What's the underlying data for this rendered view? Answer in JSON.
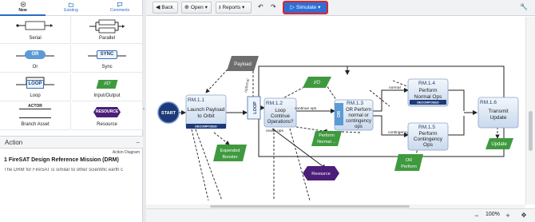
{
  "palette": {
    "tabs": [
      {
        "label": "New",
        "icon": "plus-circle-icon"
      },
      {
        "label": "Existing",
        "icon": "folder-icon"
      },
      {
        "label": "Comments",
        "icon": "comment-icon"
      }
    ],
    "items": [
      {
        "label": "Serial",
        "glyph": ""
      },
      {
        "label": "Parallel",
        "glyph": ""
      },
      {
        "label": "Or",
        "glyph": "OR"
      },
      {
        "label": "Sync",
        "glyph": "SYNC"
      },
      {
        "label": "Loop",
        "glyph": "LOOP"
      },
      {
        "label": "Input/Output",
        "glyph": "I/O"
      },
      {
        "label": "Branch Asset",
        "glyph": "ACTOR"
      },
      {
        "label": "Resource",
        "glyph": "RESOURCE"
      }
    ]
  },
  "action_panel": {
    "title": "Action",
    "collapse_icon": "−",
    "subtype": "Action Diagram",
    "name": "1 FireSAT Design Reference Mission (DRM)",
    "description": "The DRM for FireSAT is similar to other scientific earth c"
  },
  "toolbar": {
    "back": "Back",
    "open": "Open",
    "reports": "Reports",
    "simulate": "Simulate",
    "accent_color": "#2f6fd3",
    "highlight_color": "#e0232d"
  },
  "diagram": {
    "start": "START",
    "nodes": {
      "rm11": {
        "id": "RM.1.1",
        "line1": "Launch Payload",
        "line2": "to Orbit",
        "badge": "DECOMPOSED"
      },
      "rm12": {
        "id": "RM.1.2",
        "line1": "Loop",
        "line2": "Continue",
        "line3": "Operations?"
      },
      "rm13": {
        "id": "RM.1.3",
        "line1": "OR Perform",
        "line2": "normal or",
        "line3": "contingency",
        "line4": "ops"
      },
      "rm14": {
        "id": "RM.1.4",
        "line1": "Perform",
        "line2": "Normal Ops",
        "badge": "DECOMPOSED"
      },
      "rm15": {
        "id": "RM.1.5",
        "line1": "Perform",
        "line2": "Contingency",
        "line3": "Ops"
      },
      "rm16": {
        "id": "RM.1.6",
        "line1": "Transmit",
        "line2": "Update"
      }
    },
    "loop_label": "LOOP",
    "or_label": "OR",
    "io": {
      "payload": "Payload",
      "expended_booster_1": "Expended",
      "expended_booster_2": "Booster",
      "io_item": "I/O",
      "perform_normal_1": "Perform",
      "perform_normal_2": "Normal ...",
      "or_perform_1": "OR",
      "or_perform_2": "Perform",
      "update": "Update"
    },
    "resource": "Resource",
    "edge_labels": {
      "optional": "optional",
      "continue_ops": "continue ops",
      "cease_ops": "cease ops",
      "normal": "normal",
      "contingency": "contingency"
    }
  },
  "statusbar": {
    "zoom": "100%"
  }
}
